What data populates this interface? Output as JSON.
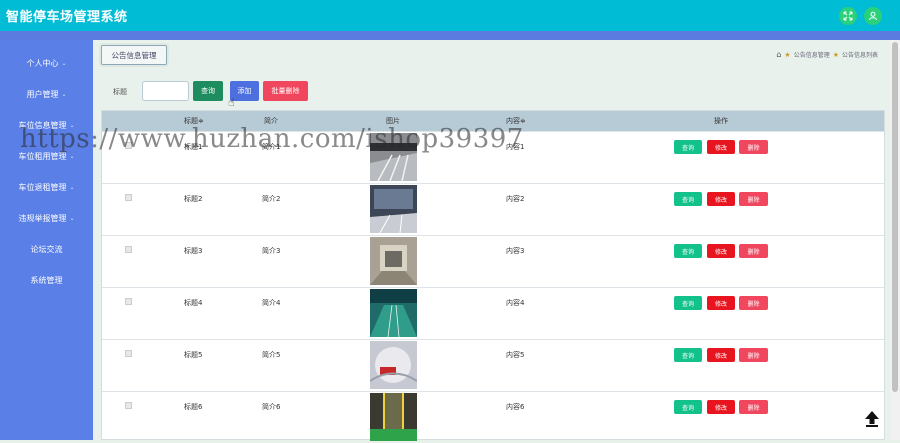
{
  "app": {
    "title": "智能停车场管理系统"
  },
  "header": {
    "icons": [
      "expand-icon",
      "user-icon"
    ]
  },
  "sidebar": {
    "items": [
      {
        "label": "个人中心"
      },
      {
        "label": "用户管理"
      },
      {
        "label": "车位信息管理"
      },
      {
        "label": "车位租用管理"
      },
      {
        "label": "车位退租管理"
      },
      {
        "label": "违规举报管理"
      },
      {
        "label": "论坛交流"
      },
      {
        "label": "系统管理"
      }
    ]
  },
  "page": {
    "tab": "公告信息管理",
    "breadcrumb": [
      "公告信息管理",
      "公告信息列表"
    ]
  },
  "filter": {
    "label": "标题",
    "placeholder": "",
    "search_btn": "查询",
    "add_btn": "添加",
    "batch_delete_btn": "批量删除"
  },
  "table": {
    "headers": {
      "title": "标题≑",
      "intro": "简介",
      "image": "图片",
      "content": "内容≑",
      "actions": "操作"
    },
    "row_actions": {
      "view": "查询",
      "edit": "修改",
      "delete": "删除"
    },
    "rows": [
      {
        "title": "标题1",
        "intro": "简介1",
        "content": "内容1"
      },
      {
        "title": "标题2",
        "intro": "简介2",
        "content": "内容2"
      },
      {
        "title": "标题3",
        "intro": "简介3",
        "content": "内容3"
      },
      {
        "title": "标题4",
        "intro": "简介4",
        "content": "内容4"
      },
      {
        "title": "标题5",
        "intro": "简介5",
        "content": "内容5"
      },
      {
        "title": "标题6",
        "intro": "简介6",
        "content": "内容6"
      }
    ]
  },
  "watermark": "https://www.huzhan.com/ishop39397",
  "colors": {
    "topbar": "#00bcd4",
    "sidebar": "#5a7fe6",
    "view": "#12c28a",
    "edit": "#e8141f",
    "delete": "#f0465e"
  }
}
